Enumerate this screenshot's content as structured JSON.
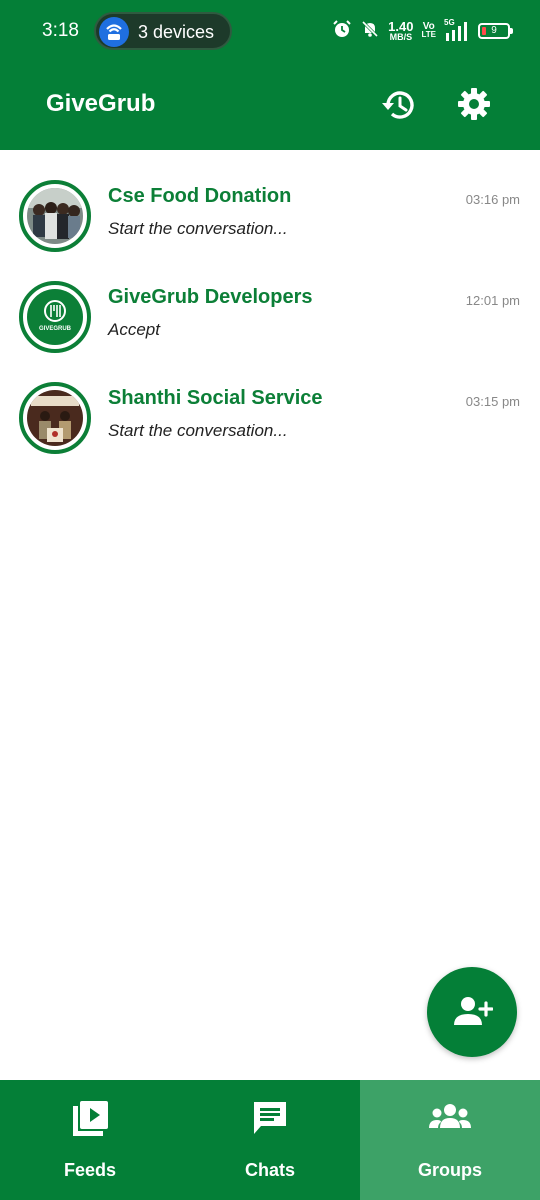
{
  "status_bar": {
    "time": "3:18",
    "hotspot_label": "3 devices",
    "speed_value": "1.40",
    "speed_unit": "MB/S",
    "volte_top": "Vo",
    "volte_bottom": "LTE",
    "network": "5G",
    "battery": "9"
  },
  "app_bar": {
    "title": "GiveGrub"
  },
  "groups": [
    {
      "name": "Cse Food Donation",
      "subtitle": "Start the conversation...",
      "time": "03:16 pm"
    },
    {
      "name": "GiveGrub Developers",
      "subtitle": "Accept",
      "time": "12:01 pm",
      "avatar_text": "GIVEGRUB"
    },
    {
      "name": "Shanthi Social Service",
      "subtitle": "Start the conversation...",
      "time": "03:15 pm"
    }
  ],
  "bottom_nav": {
    "feeds": "Feeds",
    "chats": "Chats",
    "groups": "Groups",
    "active": "groups"
  },
  "colors": {
    "primary": "#047f37",
    "accent_text": "#0c7f37",
    "active_tab": "#3da267"
  }
}
